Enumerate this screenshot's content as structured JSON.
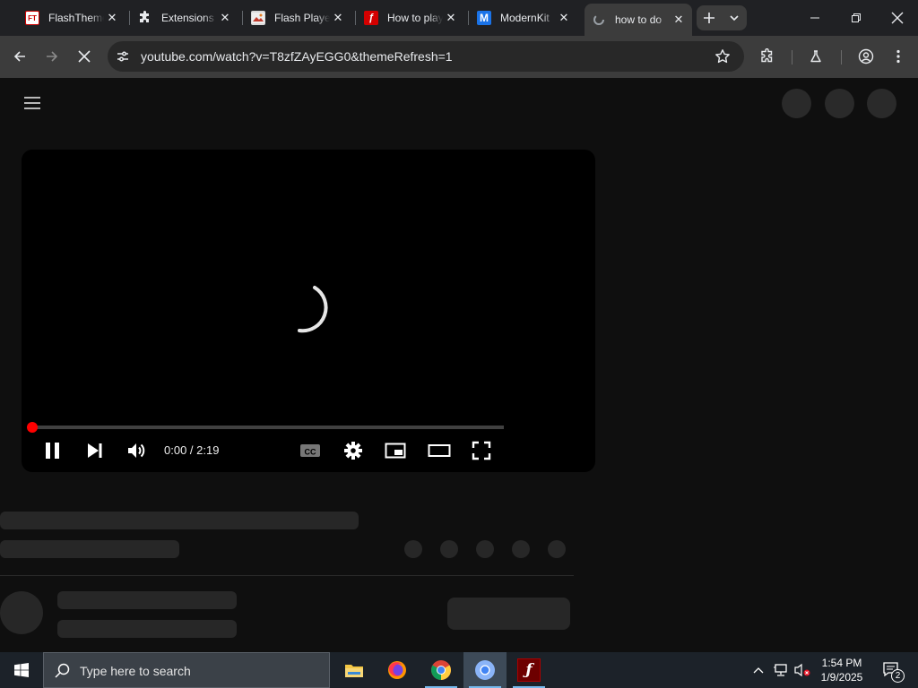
{
  "browser": {
    "tabs": [
      {
        "title": "FlashThemes",
        "icon": "flashthemes-icon",
        "active": false
      },
      {
        "title": "Extensions",
        "icon": "puzzle-icon",
        "active": false
      },
      {
        "title": "Flash Player",
        "icon": "flash-player-site-icon",
        "active": false
      },
      {
        "title": "How to play",
        "icon": "flash-icon",
        "active": false
      },
      {
        "title": "ModernKit",
        "icon": "modernkit-icon",
        "active": false
      },
      {
        "title": "how to do",
        "icon": "loading-icon",
        "active": true
      }
    ],
    "address": {
      "url": "youtube.com/watch?v=T8zfZAyEGG0&themeRefresh=1"
    },
    "colors": {
      "accent": "#ff0000",
      "tabstrip": "#202124",
      "toolbar": "#3c3c3c"
    }
  },
  "player": {
    "time_display": "0:00 / 2:19",
    "progress_fraction": 0.0,
    "state": "loading",
    "controls": [
      "pause",
      "next",
      "volume",
      "captions",
      "settings",
      "miniplayer",
      "theater",
      "fullscreen"
    ]
  },
  "taskbar": {
    "search_placeholder": "Type here to search",
    "time": "1:54 PM",
    "date": "1/9/2025",
    "notification_count": "2",
    "pinned_apps": [
      "file-explorer",
      "firefox",
      "chrome",
      "chromium",
      "flash-player"
    ]
  }
}
